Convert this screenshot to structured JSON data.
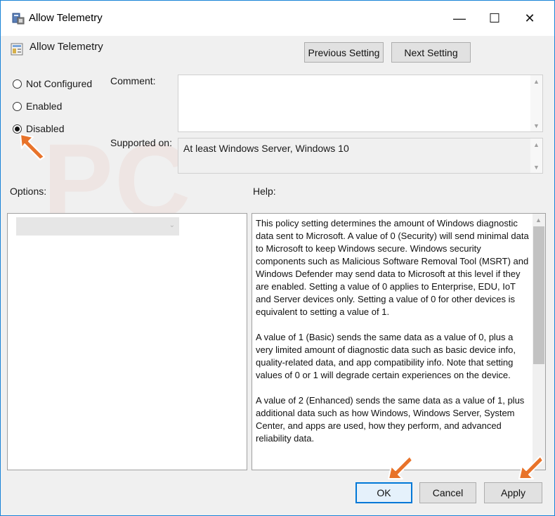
{
  "window": {
    "title": "Allow Telemetry",
    "minimize_symbol": "—",
    "maximize_symbol": "☐",
    "close_symbol": "✕"
  },
  "policy": {
    "name": "Allow Telemetry"
  },
  "nav": {
    "previous_label": "Previous Setting",
    "next_label": "Next Setting"
  },
  "state": {
    "options": [
      {
        "label": "Not Configured",
        "selected": false
      },
      {
        "label": "Enabled",
        "selected": false
      },
      {
        "label": "Disabled",
        "selected": true
      }
    ]
  },
  "fields": {
    "comment_label": "Comment:",
    "comment_value": "",
    "supported_label": "Supported on:",
    "supported_value": "At least Windows Server, Windows 10"
  },
  "panes": {
    "options_label": "Options:",
    "help_label": "Help:",
    "options_combo_value": "",
    "help_text": "This policy setting determines the amount of Windows diagnostic data sent to Microsoft. A value of 0 (Security) will send minimal data to Microsoft to keep Windows secure. Windows security components such as Malicious Software Removal Tool (MSRT) and Windows Defender may send data to Microsoft at this level if they are enabled. Setting a value of 0 applies to Enterprise, EDU, IoT and Server devices only. Setting a value of 0 for other devices is equivalent to setting a value of 1.\n\nA value of 1 (Basic) sends the same data as a value of 0, plus a very limited amount of diagnostic data such as basic device info, quality-related data, and app compatibility info. Note that setting values of 0 or 1 will degrade certain experiences on the device.\n\nA value of 2 (Enhanced) sends the same data as a value of 1, plus additional data such as how Windows, Windows Server, System Center, and apps are used, how they perform, and advanced reliability data."
  },
  "footer": {
    "ok_label": "OK",
    "cancel_label": "Cancel",
    "apply_label": "Apply"
  },
  "colors": {
    "accent": "#0078d7",
    "annotation_arrow": "#e8732a"
  },
  "icons": {
    "title": "policy-app-icon",
    "policy": "policy-setting-icon",
    "annotation": "orange-pointer-arrow-icon"
  }
}
